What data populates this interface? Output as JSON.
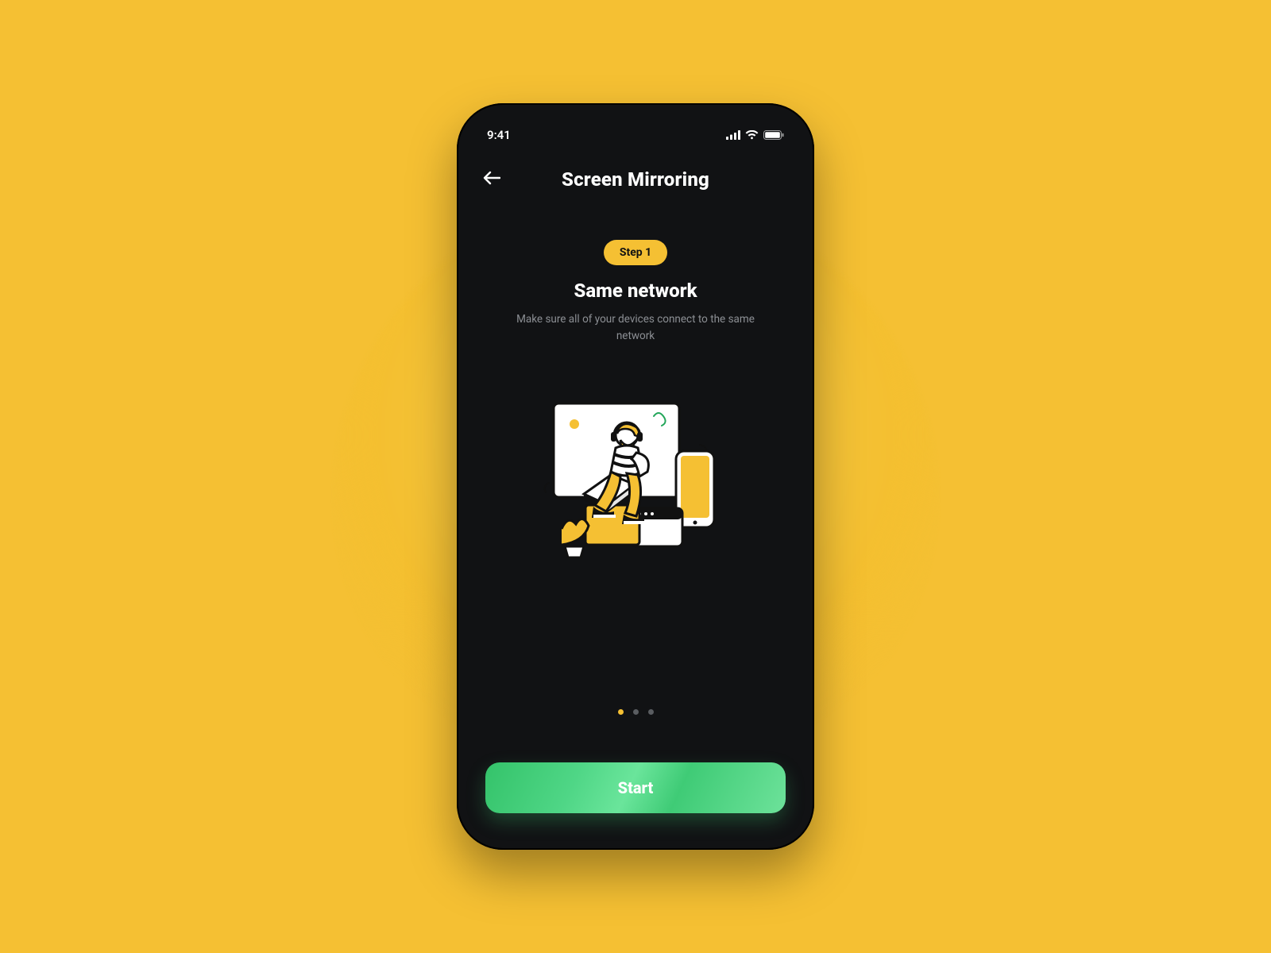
{
  "colors": {
    "background": "#f5c033",
    "phone_bg": "#111214",
    "accent": "#f5c033",
    "cta": "#4fd686",
    "muted": "#8c8f94"
  },
  "status_bar": {
    "time": "9:41",
    "signal_icon": "cellular-signal-icon",
    "wifi_icon": "wifi-icon",
    "battery_icon": "battery-full-icon"
  },
  "header": {
    "back_icon": "arrow-left-icon",
    "title": "Screen Mirroring"
  },
  "onboarding": {
    "step_badge": "Step 1",
    "heading": "Same network",
    "description": "Make sure all of your devices connect to the same network",
    "illustration_name": "person-with-laptop-devices-illustration"
  },
  "pagination": {
    "count": 3,
    "active_index": 0
  },
  "cta": {
    "label": "Start"
  }
}
